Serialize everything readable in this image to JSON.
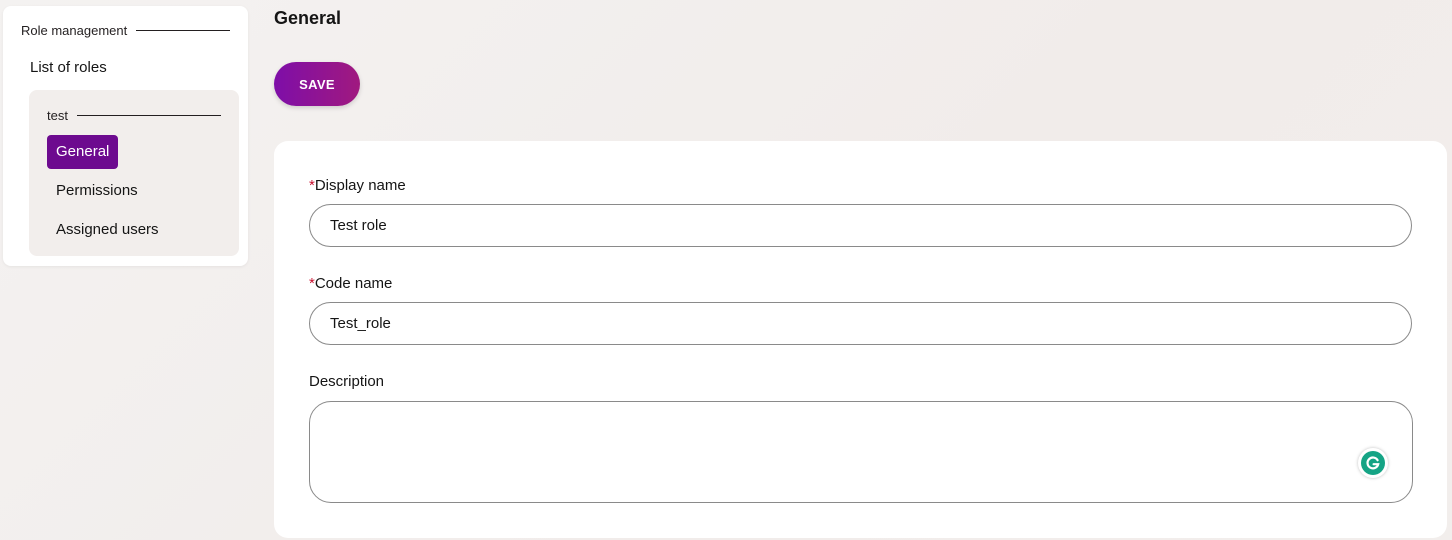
{
  "sidebar": {
    "section_title": "Role management",
    "list_link": "List of roles",
    "role_name": "test",
    "items": [
      {
        "label": "General",
        "active": true
      },
      {
        "label": "Permissions",
        "active": false
      },
      {
        "label": "Assigned users",
        "active": false
      }
    ]
  },
  "main": {
    "title": "General",
    "save_label": "SAVE",
    "form": {
      "display_name": {
        "required_mark": "*",
        "label": "Display name",
        "value": "Test role"
      },
      "code_name": {
        "required_mark": "*",
        "label": "Code name",
        "value": "Test_role"
      },
      "description": {
        "label": "Description",
        "value": ""
      }
    }
  },
  "icons": {
    "grammarly": "grammarly-icon"
  },
  "colors": {
    "accent": "#6d0a8f",
    "button_gradient_start": "#7e0ea8",
    "button_gradient_end": "#a0197f",
    "required": "#c8102e",
    "grammarly": "#15a485"
  }
}
